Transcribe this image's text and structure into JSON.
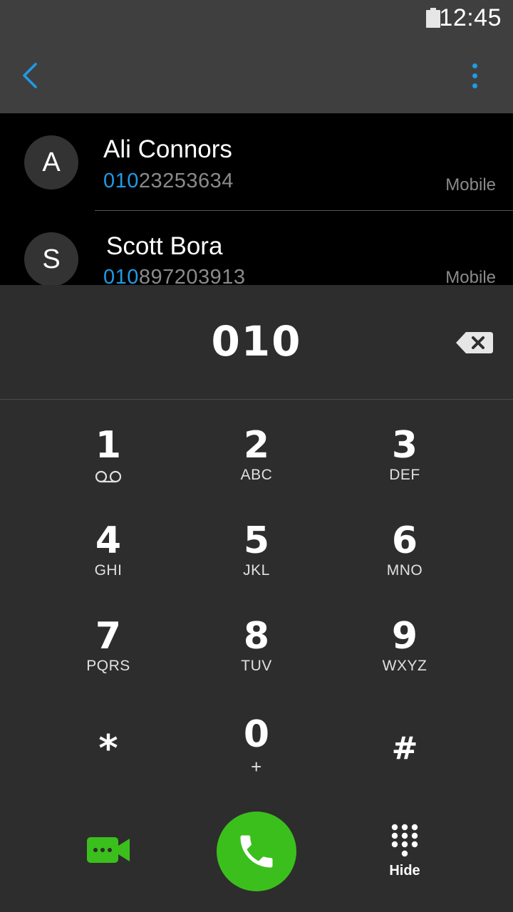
{
  "status_bar": {
    "time": "12:45",
    "battery_icon": "battery-full-icon"
  },
  "app_bar": {
    "back_icon": "chevron-left-icon",
    "menu_icon": "more-vert-icon",
    "accent_color": "#1e9be6"
  },
  "contacts": [
    {
      "initial": "A",
      "name": "Ali Connors",
      "number_match": "010",
      "number_rest": "23253634",
      "type": "Mobile"
    },
    {
      "initial": "S",
      "name": "Scott Bora",
      "number_match": "010",
      "number_rest": "897203913",
      "type": "Mobile"
    }
  ],
  "dialer": {
    "entered_digits": "010",
    "backspace_icon": "backspace-icon",
    "keys": [
      {
        "digit": "1",
        "letters": "",
        "icon": "voicemail-icon"
      },
      {
        "digit": "2",
        "letters": "ABC"
      },
      {
        "digit": "3",
        "letters": "DEF"
      },
      {
        "digit": "4",
        "letters": "GHI"
      },
      {
        "digit": "5",
        "letters": "JKL"
      },
      {
        "digit": "6",
        "letters": "MNO"
      },
      {
        "digit": "7",
        "letters": "PQRS"
      },
      {
        "digit": "8",
        "letters": "TUV"
      },
      {
        "digit": "9",
        "letters": "WXYZ"
      },
      {
        "digit": "*",
        "letters": ""
      },
      {
        "digit": "0",
        "letters": "+"
      },
      {
        "digit": "#",
        "letters": ""
      }
    ]
  },
  "actions": {
    "video_icon": "video-call-icon",
    "call_icon": "phone-icon",
    "call_color": "#3bbf1c",
    "hide_icon": "dialpad-icon",
    "hide_label": "Hide"
  }
}
